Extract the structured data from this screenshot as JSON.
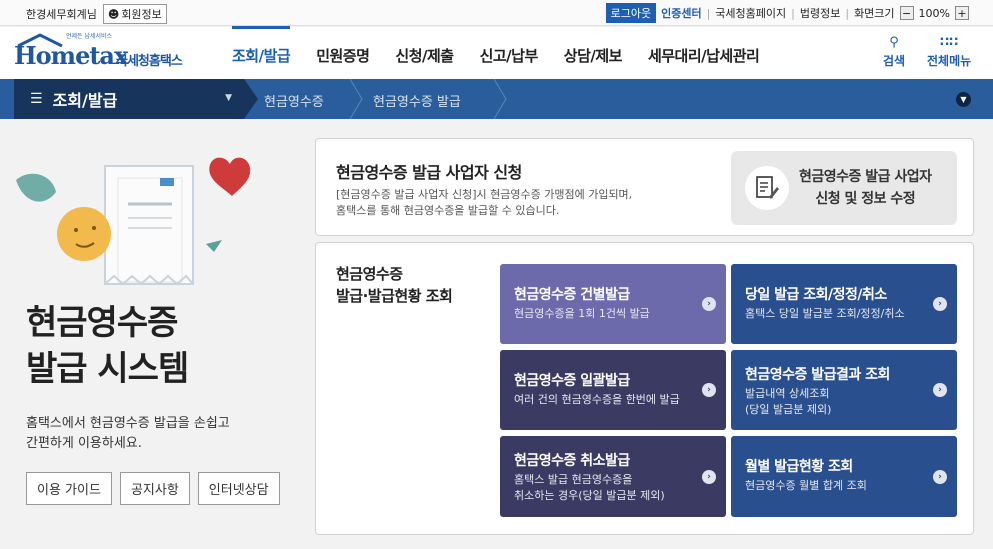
{
  "topbar": {
    "office": "한경세무회계님",
    "member_info": "회원정보",
    "login": "로그아웃",
    "cert_center": "인증센터",
    "nts_home": "국세청홈페이지",
    "law_info": "법령정보",
    "screen_size": "화면크기",
    "zoom_minus": "−",
    "zoom_value": "100%",
    "zoom_plus": "+"
  },
  "logo": {
    "home": "Hometax",
    "sub": "언제든 납세서비스",
    "nts": "국세청홈택스"
  },
  "nav": {
    "items": [
      "조회/발급",
      "민원증명",
      "신청/제출",
      "신고/납부",
      "상담/제보",
      "세무대리/납세관리"
    ],
    "search": "검색",
    "all_menu": "전체메뉴"
  },
  "breadcrumb": {
    "main": "조회/발급",
    "c1": "현금영수증",
    "c2": "현금영수증 발급"
  },
  "hero": {
    "title_line1": "현금영수증",
    "title_line2": "발급 시스템",
    "desc_line1": "홈택스에서 현금영수증 발급을 손쉽고",
    "desc_line2": "간편하게 이용하세요.",
    "buttons": [
      "이용 가이드",
      "공지사항",
      "인터넷상담"
    ]
  },
  "panel1": {
    "title": "현금영수증 발급 사업자 신청",
    "desc_line1": "[현금영수증 발급 사업자 신청]시 현금영수증 가맹점에 가입되며,",
    "desc_line2": "홈택스를 통해 현금영수증을 발급할 수 있습니다.",
    "apply_line1": "현금영수증 발급 사업자",
    "apply_line2": "신청 및 정보 수정"
  },
  "panel2": {
    "title_line1": "현금영수증",
    "title_line2": "발급·발급현황 조회",
    "tiles": [
      {
        "title": "현금영수증 건별발급",
        "desc1": "현금영수증을 1회 1건씩 발급",
        "desc2": ""
      },
      {
        "title": "당일 발급 조회/정정/취소",
        "desc1": "홈택스 당일 발급분 조회/정정/취소",
        "desc2": ""
      },
      {
        "title": "현금영수증 일괄발급",
        "desc1": "여러 건의 현금영수증을 한번에 발급",
        "desc2": ""
      },
      {
        "title": "현금영수증 발급결과 조회",
        "desc1": "발급내역 상세조회",
        "desc2": "(당일 발급분 제외)"
      },
      {
        "title": "현금영수증 취소발급",
        "desc1": "홈택스 발급 현금영수증을",
        "desc2": "취소하는 경우(당일 발급분 제외)"
      },
      {
        "title": "월별 발급현황 조회",
        "desc1": "현금영수증 월별 합계 조회",
        "desc2": ""
      }
    ],
    "go": "›"
  },
  "colors": {
    "brand": "#1d5fb3",
    "navy": "#17345c",
    "tile_purple": "#6c6aab",
    "tile_dark_purple": "#3b3a62",
    "tile_blue": "#2a4f8e"
  }
}
